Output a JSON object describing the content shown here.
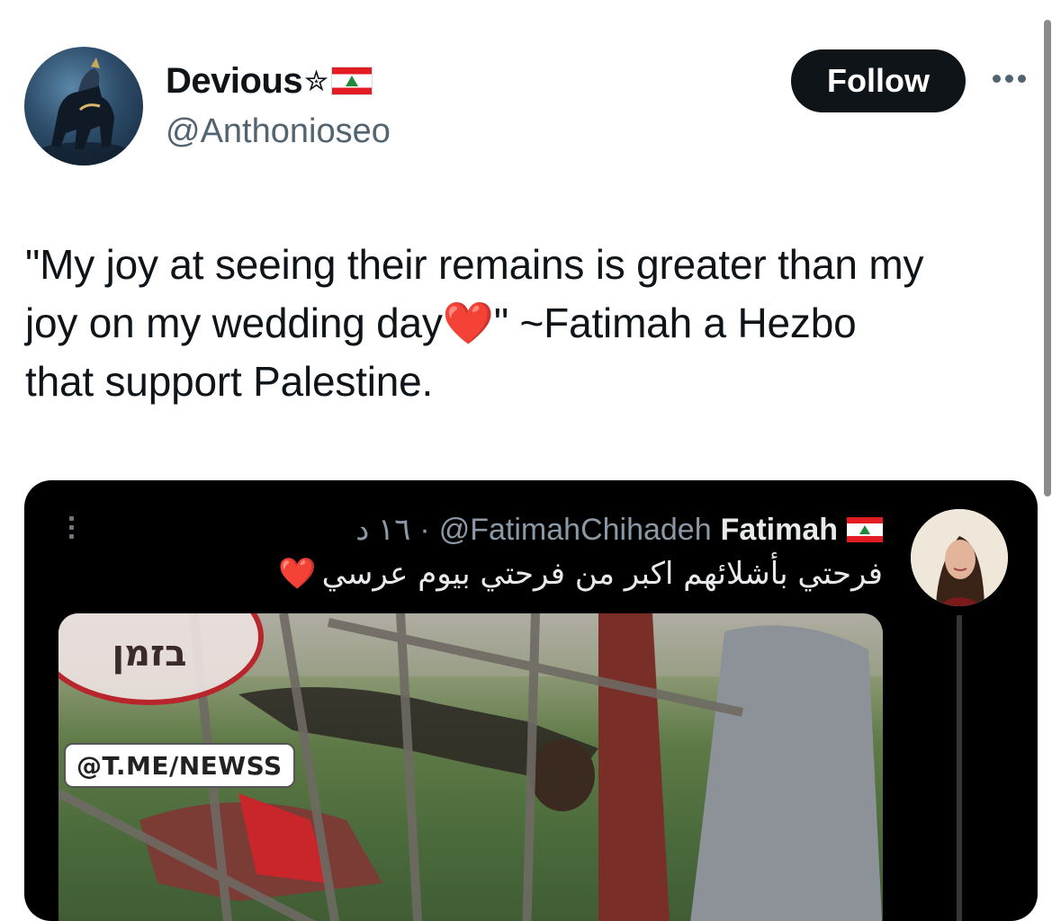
{
  "author": {
    "display_name": "Devious",
    "star": "✮",
    "flag_icon": "lebanon-flag-icon",
    "handle": "@Anthonioseo"
  },
  "follow_label": "Follow",
  "more_icon": "more-horizontal-icon",
  "tweet": {
    "text_before_heart": "\"My joy at seeing their remains is greater than my\njoy on my wedding day",
    "heart": "❤️",
    "text_after_heart": "\" ~Fatimah a Hezbo\nthat support Palestine."
  },
  "quoted": {
    "name": "Fatimah",
    "handle": "@FatimahChihadeh",
    "separator": "·",
    "time": "١٦ د",
    "text": "فرحتي بأشلائهم اكبر من فرحتي بيوم عرسي",
    "heart": "❤️",
    "badge_text": "בזמן",
    "watermark": "@T.ME/NEWSS"
  },
  "colors": {
    "follow_bg": "#0f1419",
    "secondary_text": "#536471",
    "media_bg": "#000000",
    "heart": "#e0111b"
  }
}
